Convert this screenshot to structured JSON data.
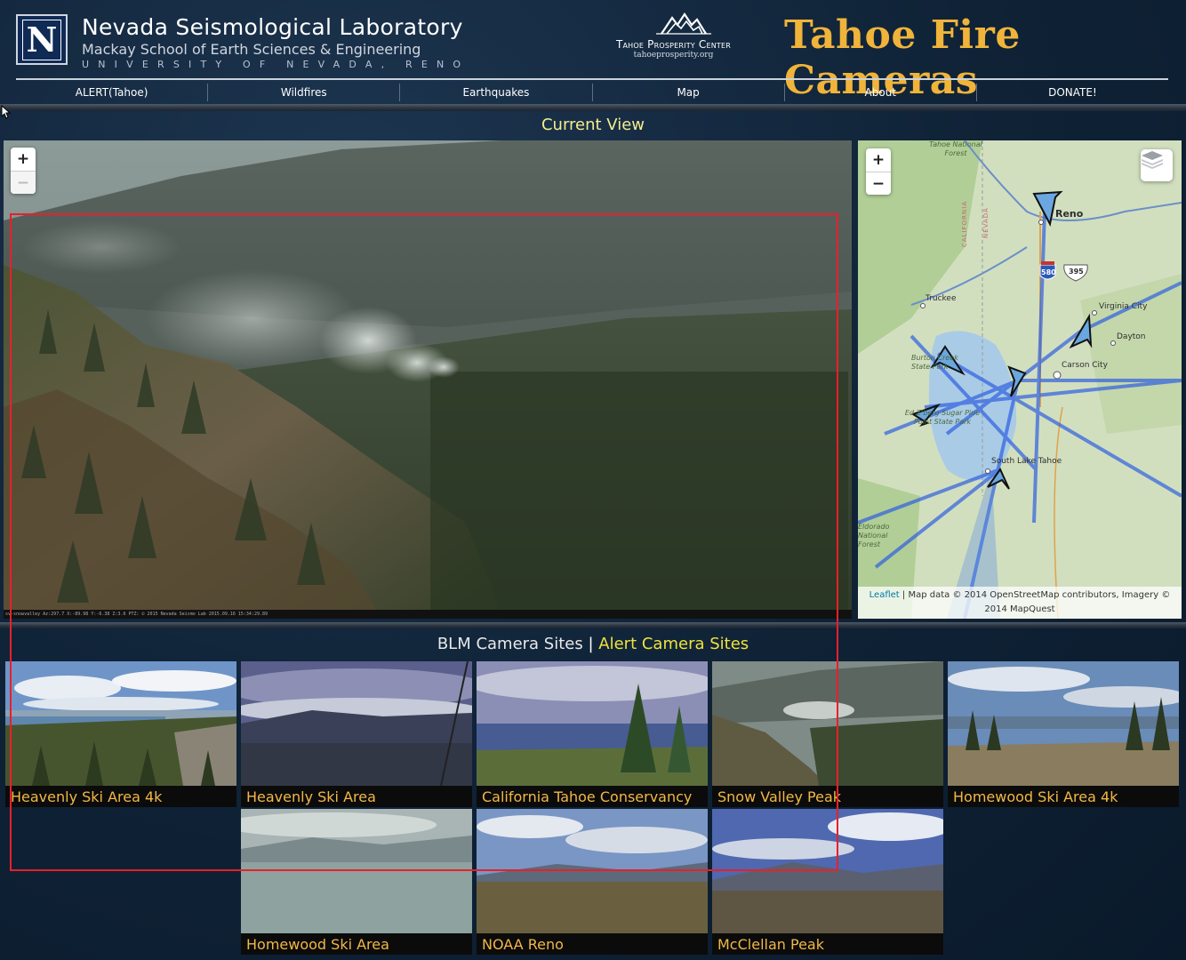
{
  "header": {
    "logo_letter": "N",
    "org_title": "Nevada Seismological Laboratory",
    "org_subtitle": "Mackay School of Earth Sciences & Engineering",
    "university": "UNIVERSITY OF NEVADA, RENO",
    "partner_name": "Tahoe Prosperity Center",
    "partner_url": "tahoeprosperity.org",
    "site_title": "Tahoe Fire Cameras"
  },
  "nav": {
    "items": [
      "ALERT(Tahoe)",
      "Wildfires",
      "Earthquakes",
      "Map",
      "About",
      "DONATE!"
    ]
  },
  "current_view": {
    "title": "Current View",
    "zoom_in": "+",
    "zoom_out": "−",
    "caption": "sv-snowvalley Az:297.7 X:-89.98 Y:-6.38 Z:3.6 PTZ: © 2015 Nevada Seismo Lab 2015.09.16 15:34:29.89"
  },
  "map": {
    "zoom_in": "+",
    "zoom_out": "−",
    "labels": {
      "tahoe_forest": "Tahoe National Forest",
      "reno": "Reno",
      "truckee": "Truckee",
      "virginia_city": "Virginia City",
      "dayton": "Dayton",
      "carson_city": "Carson City",
      "south_lake_tahoe": "South Lake Tahoe",
      "burton_creek": "Burton Creek State Park",
      "sugar_pine": "Ed Z'berg Sugar Pine Point State Park",
      "eldorado": "Eldorado National Forest",
      "california": "CALIFORNIA",
      "nevada": "NEVADA",
      "i580": "580",
      "us395": "395"
    },
    "attribution_link": "Leaflet",
    "attribution_text": "| Map data © 2014 OpenStreetMap contributors, Imagery © 2014 MapQuest"
  },
  "sites": {
    "blm_label": "BLM Camera Sites",
    "separator": "|",
    "alert_label": "Alert Camera Sites",
    "cameras": [
      {
        "name": "Heavenly Ski Area 4k"
      },
      {
        "name": "Heavenly Ski Area"
      },
      {
        "name": "California Tahoe Conservancy"
      },
      {
        "name": "Snow Valley Peak"
      },
      {
        "name": "Homewood Ski Area 4k"
      },
      {
        "name": "Homewood Ski Area"
      },
      {
        "name": "NOAA Reno"
      },
      {
        "name": "McClellan Peak"
      }
    ]
  },
  "colors": {
    "accent_gold": "#f0b43a",
    "alert_yellow": "#f0e23c",
    "background": "#0f2236",
    "highlight_red": "#e8202a"
  }
}
